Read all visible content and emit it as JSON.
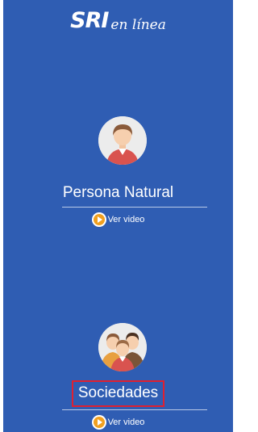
{
  "header": {
    "logo_brand": "SRI",
    "logo_tagline": "en línea"
  },
  "options": [
    {
      "title": "Persona Natural",
      "avatar_icon": "single-person-icon",
      "video_label": "Ver video",
      "video_icon": "play-icon",
      "highlighted": false
    },
    {
      "title": "Sociedades",
      "avatar_icon": "group-people-icon",
      "video_label": "Ver video",
      "video_icon": "play-icon",
      "highlighted": true
    }
  ],
  "colors": {
    "background": "#2f5db3",
    "highlight_box": "#e02030",
    "play_button": "#f0a020"
  }
}
